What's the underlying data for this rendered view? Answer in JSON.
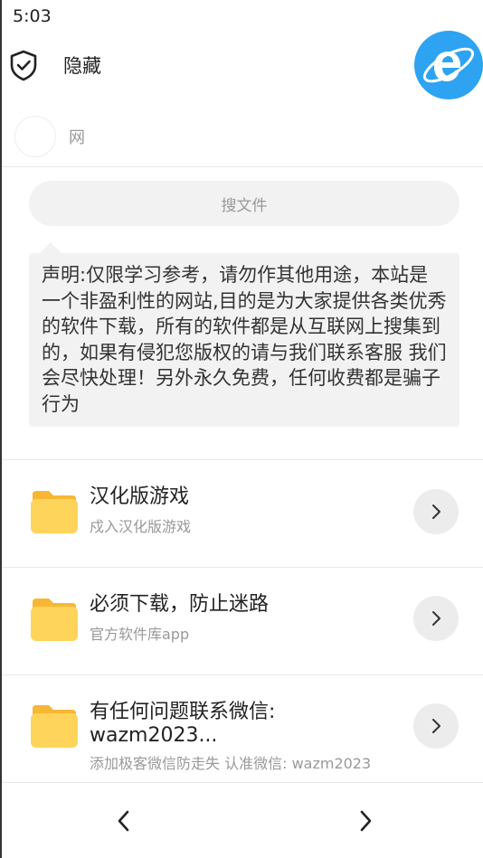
{
  "status": {
    "time": "5:03"
  },
  "header": {
    "hide_label": "隐藏"
  },
  "profile": {
    "name": "网"
  },
  "search": {
    "placeholder": "搜文件"
  },
  "notice": {
    "text": "声明:仅限学习参考，请勿作其他用途，本站是一个非盈利性的网站,目的是为大家提供各类优秀的软件下载，所有的软件都是从互联网上搜集到的，如果有侵犯您版权的请与我们联系客服 我们会尽快处理！另外永久免费，任何收费都是骗子行为"
  },
  "items": [
    {
      "title": "汉化版游戏",
      "subtitle": "戍入汉化版游戏"
    },
    {
      "title": "必须下载，防止迷路",
      "subtitle": "官方软件库app"
    },
    {
      "title_line1": "有任何问题联系微信:",
      "title_line2": "wazm2023...",
      "subtitle": "添加极客微信防走失 认准微信: wazm2023"
    }
  ],
  "icons": {
    "shield": "shield-check-icon",
    "logo": "ie-browser-icon",
    "folder": "folder-icon",
    "chevron": "chevron-right-icon",
    "back": "chevron-left-icon",
    "forward": "chevron-right-icon"
  },
  "colors": {
    "folder": "#ffd45a",
    "folder_tab": "#f7b733",
    "logo": "#2ea3f2"
  }
}
